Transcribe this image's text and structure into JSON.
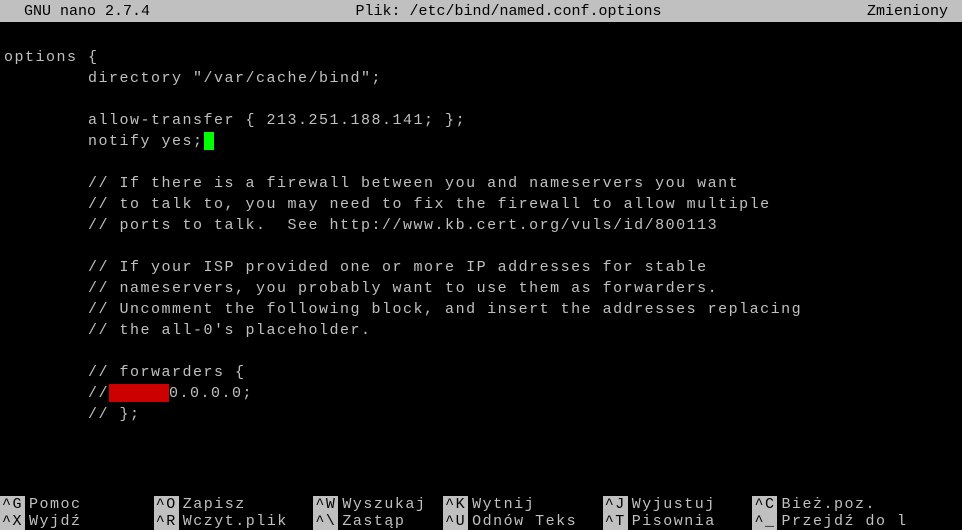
{
  "titlebar": {
    "app": "GNU nano",
    "version": "2.7.4",
    "file_label": "Plik:",
    "file_path": "/etc/bind/named.conf.options",
    "status": "Zmieniony"
  },
  "editor": {
    "lines": [
      "",
      "options {",
      "        directory \"/var/cache/bind\";",
      "",
      "        allow-transfer { 213.251.188.141; };",
      "        notify yes;",
      "",
      "        // If there is a firewall between you and nameservers you want",
      "        // to talk to, you may need to fix the firewall to allow multiple",
      "        // ports to talk.  See http://www.kb.cert.org/vuls/id/800113",
      "",
      "        // If your ISP provided one or more IP addresses for stable",
      "        // nameservers, you probably want to use them as forwarders.",
      "        // Uncomment the following block, and insert the addresses replacing",
      "        // the all-0's placeholder.",
      "",
      "        // forwarders {",
      "        //",
      "        // };"
    ],
    "forwarder_suffix": "0.0.0.0;"
  },
  "shortcuts": {
    "row1": [
      {
        "key": "^G",
        "label": "Pomoc"
      },
      {
        "key": "^O",
        "label": "Zapisz"
      },
      {
        "key": "^W",
        "label": "Wyszukaj"
      },
      {
        "key": "^K",
        "label": "Wytnij"
      },
      {
        "key": "^J",
        "label": "Wyjustuj"
      },
      {
        "key": "^C",
        "label": "Bież.poz."
      }
    ],
    "row2": [
      {
        "key": "^X",
        "label": "Wyjdź"
      },
      {
        "key": "^R",
        "label": "Wczyt.plik"
      },
      {
        "key": "^\\",
        "label": "Zastąp"
      },
      {
        "key": "^U",
        "label": "Odnów Teks"
      },
      {
        "key": "^T",
        "label": "Pisownia"
      },
      {
        "key": "^_",
        "label": "Przejdź do l"
      }
    ]
  }
}
